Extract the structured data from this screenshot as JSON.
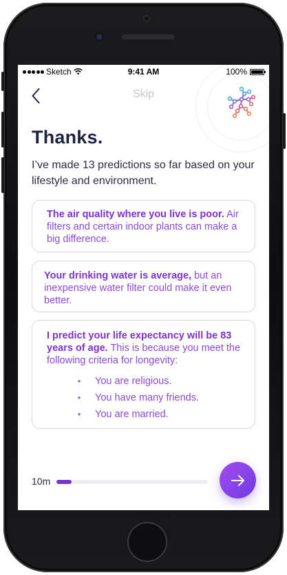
{
  "status_bar": {
    "carrier": "Sketch",
    "time": "9:41 AM",
    "battery": "100%"
  },
  "nav": {
    "skip_label": "Skip"
  },
  "heading": "Thanks.",
  "intro": "I’ve made 13 predictions so far based on your lifestyle and environment.",
  "cards": [
    {
      "bold": "The air quality where you live is poor.",
      "text": " Air filters and certain indoor plants can make a big difference."
    },
    {
      "bold": "Your drinking water is average,",
      "text": " but an inexpensive water filter could make it even better."
    },
    {
      "bold": "I predict your life expectancy will be 83 years of age.",
      "text": " This is because you meet the following criteria for longevity:",
      "criteria": [
        "You are religious.",
        "You have many friends.",
        "You are married."
      ]
    }
  ],
  "footer": {
    "timer_label": "10m",
    "progress": 0.1
  },
  "colors": {
    "accent": "#7b33cf",
    "title": "#1e2340",
    "card_border": "#d8d7e2"
  },
  "icons": {
    "back": "chevron-left-icon",
    "next": "arrow-right-icon",
    "logo": "network-logo"
  }
}
